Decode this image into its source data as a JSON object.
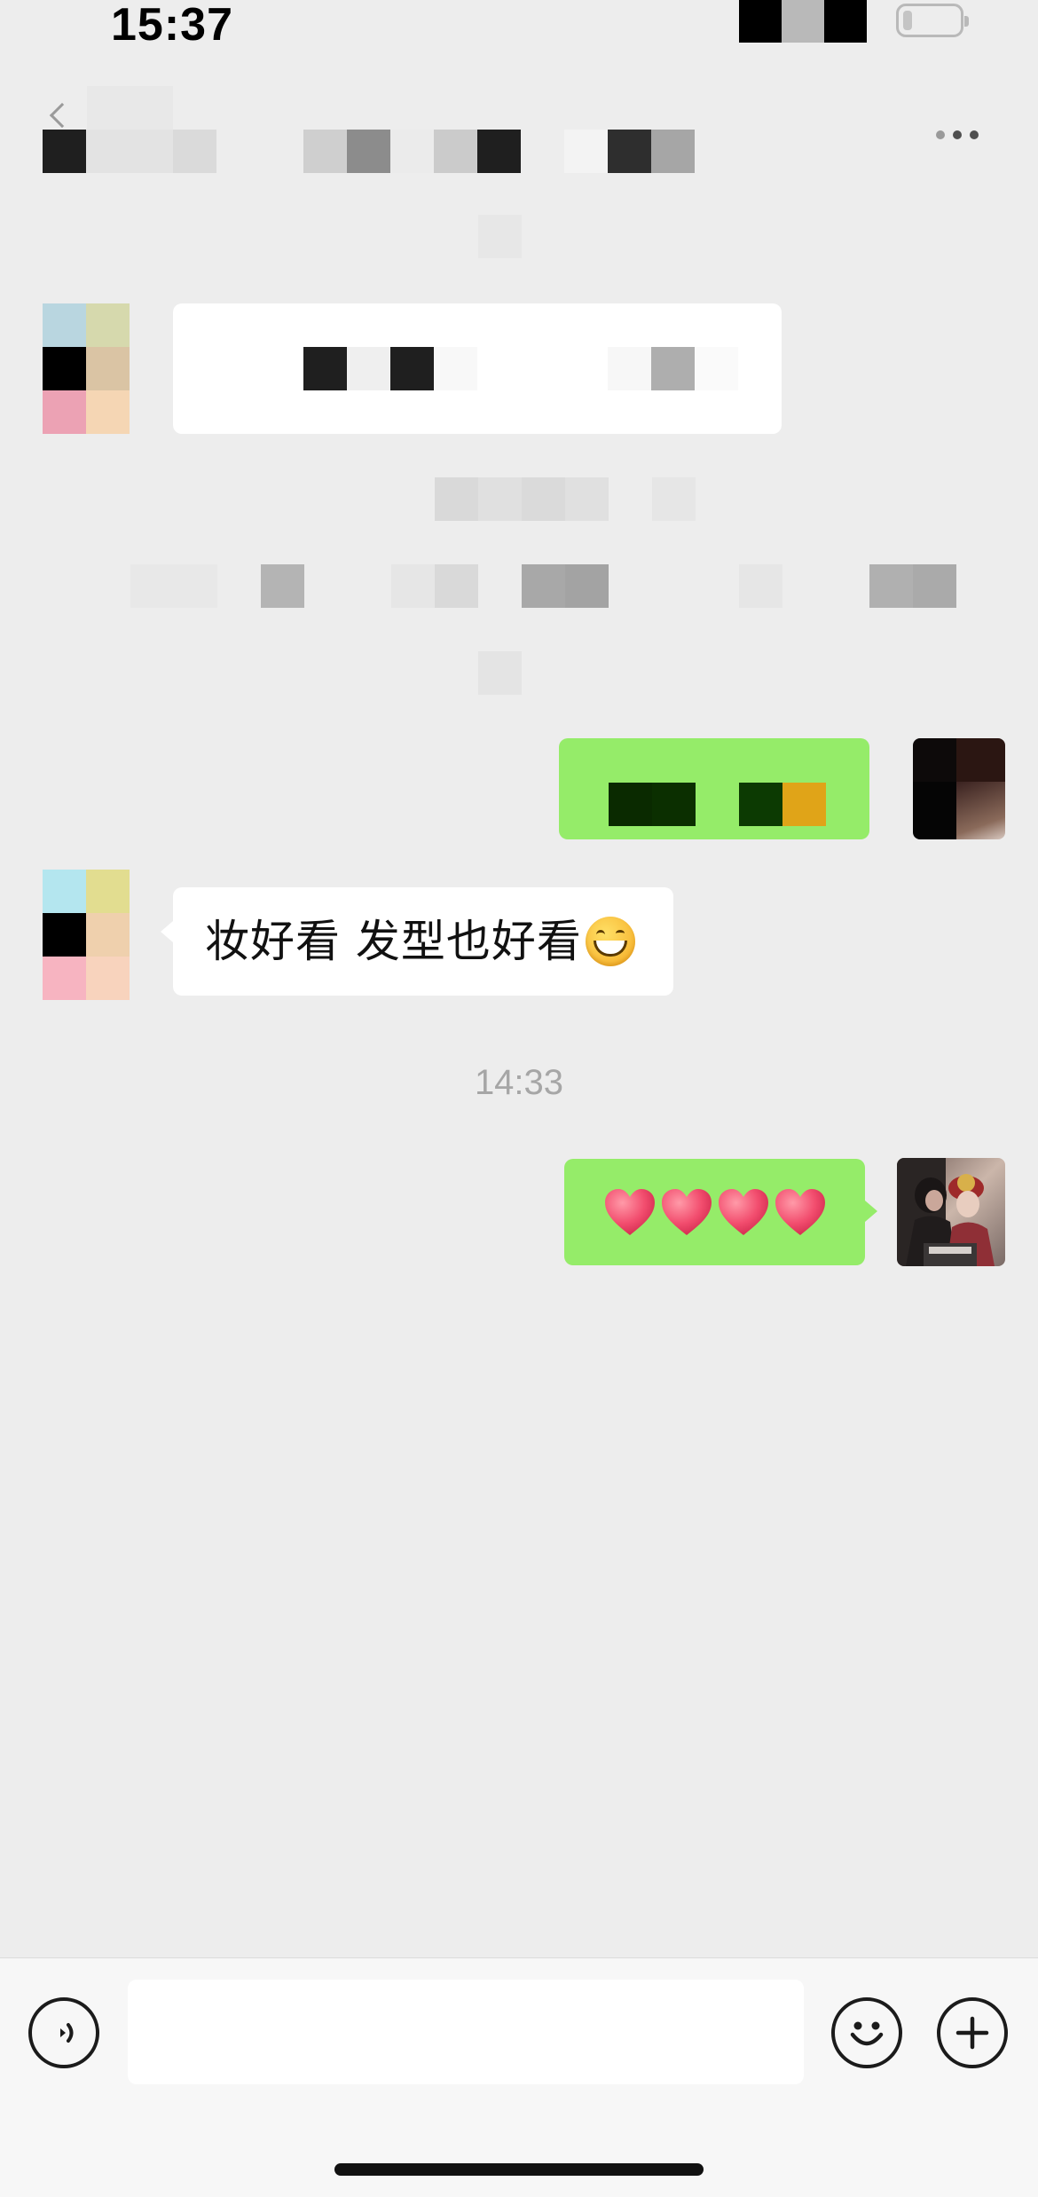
{
  "status_bar": {
    "time": "15:37"
  },
  "nav": {
    "back_icon": "chevron-left-icon",
    "more_icon": "ellipsis-icon"
  },
  "messages": {
    "reply_text": "妆好看 发型也好看",
    "reply_emoji": "grinning-face-emoji",
    "timestamp": "14:33",
    "hearts_emoji": "red-heart-emoji",
    "hearts_count": 4
  },
  "input_bar": {
    "voice_icon": "voice-icon",
    "emoji_icon": "smiley-icon",
    "plus_icon": "plus-icon"
  },
  "colors": {
    "background": "#ededed",
    "bubble_green": "#95ec69",
    "bubble_white": "#ffffff",
    "timestamp_gray": "#a6a6a6"
  }
}
